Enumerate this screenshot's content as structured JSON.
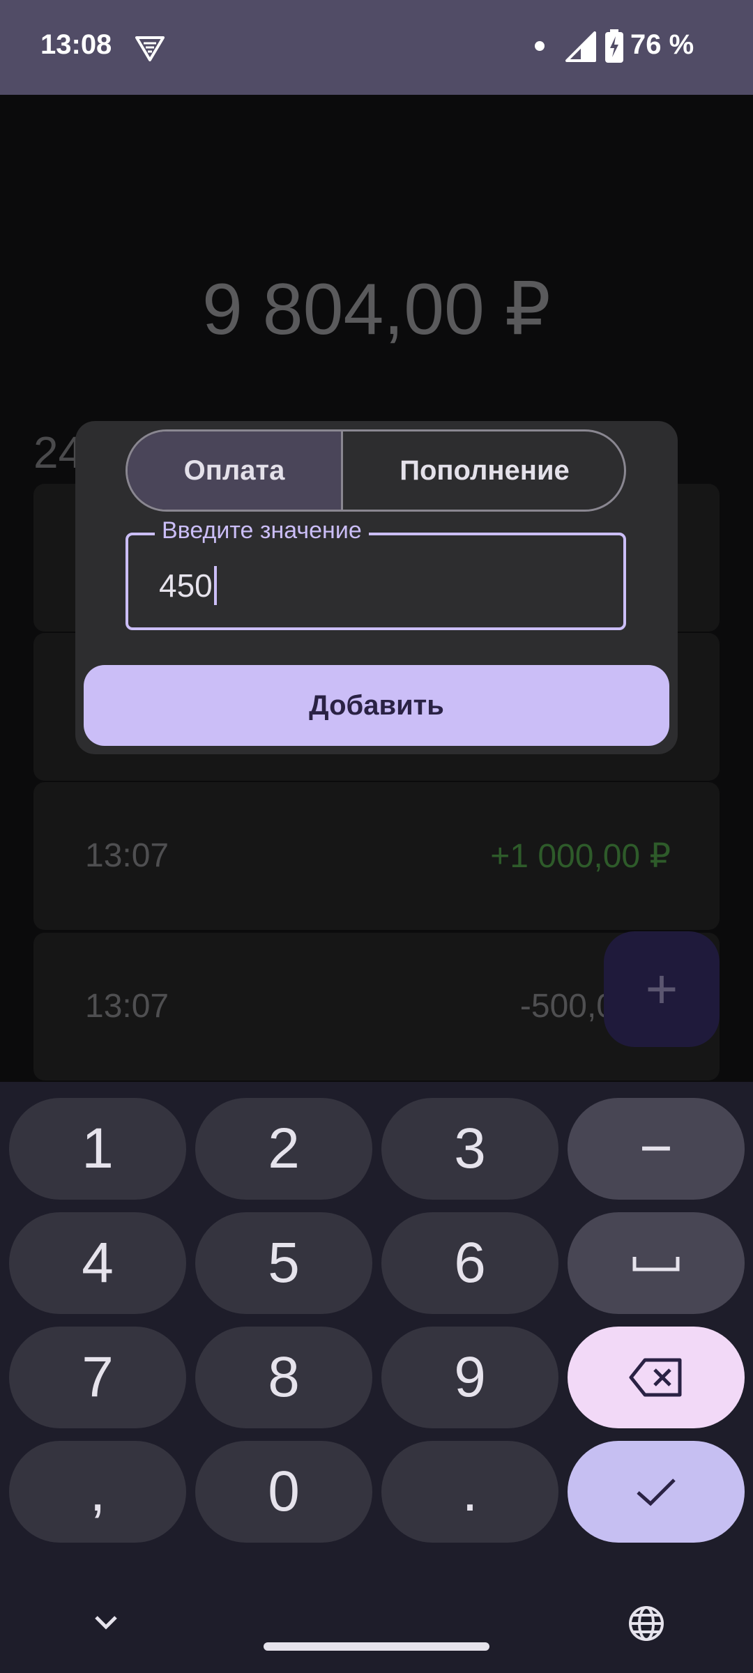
{
  "status_bar": {
    "time": "13:08",
    "battery_percent": "76 %",
    "icons": [
      "vpn-icon",
      "notification-dot",
      "signal-icon",
      "battery-charging-icon"
    ]
  },
  "main": {
    "balance": "9 804,00 ₽",
    "date_partial": "24",
    "transactions": [
      {
        "time": "13:07",
        "amount": "+1 000,00 ₽"
      },
      {
        "time": "13:07",
        "amount": "-500,0"
      }
    ],
    "fab_symbol": "+"
  },
  "dialog": {
    "segments": [
      {
        "label": "Оплата",
        "selected": true
      },
      {
        "label": "Пополнение",
        "selected": false
      }
    ],
    "input": {
      "label": "Введите значение",
      "value": "450"
    },
    "add_button": "Добавить"
  },
  "keyboard": {
    "keys": [
      "1",
      "2",
      "3",
      "−",
      "4",
      "5",
      "6",
      "␣",
      "7",
      "8",
      "9",
      "⌫",
      ",",
      "0",
      ".",
      "✓"
    ]
  },
  "colors": {
    "status_bar": "#514c66",
    "accent": "#cbbef7",
    "dialog_bg": "#2d2d2f",
    "keyboard_bg": "#1e1d2a",
    "positive_amount": "#2e5b2a"
  }
}
